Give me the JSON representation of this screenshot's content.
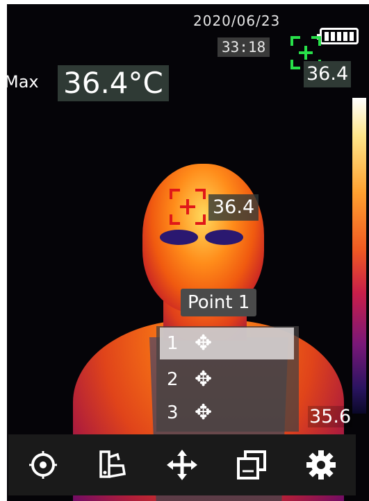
{
  "status": {
    "date": "2020/06/23",
    "time": "33:18",
    "battery_level": 1.0
  },
  "readout": {
    "max_label": "Max",
    "max_value": "36.4°C",
    "cursor_value": "36.4"
  },
  "scale": {
    "high": "36.4",
    "low": "35.6"
  },
  "point_menu": {
    "title": "Point 1",
    "items": [
      {
        "label": "1",
        "icon": "move-icon",
        "selected": true
      },
      {
        "label": "2",
        "icon": "move-icon",
        "selected": false
      },
      {
        "label": "3",
        "icon": "move-icon",
        "selected": false
      }
    ]
  },
  "toolbar": {
    "buttons": [
      {
        "icon": "target-icon"
      },
      {
        "icon": "palette-icon"
      },
      {
        "icon": "move-icon"
      },
      {
        "icon": "image-mode-icon"
      },
      {
        "icon": "settings-icon"
      }
    ]
  },
  "colors": {
    "cursor_spot": "#e01818",
    "cursor_cold": "#28e04a"
  }
}
